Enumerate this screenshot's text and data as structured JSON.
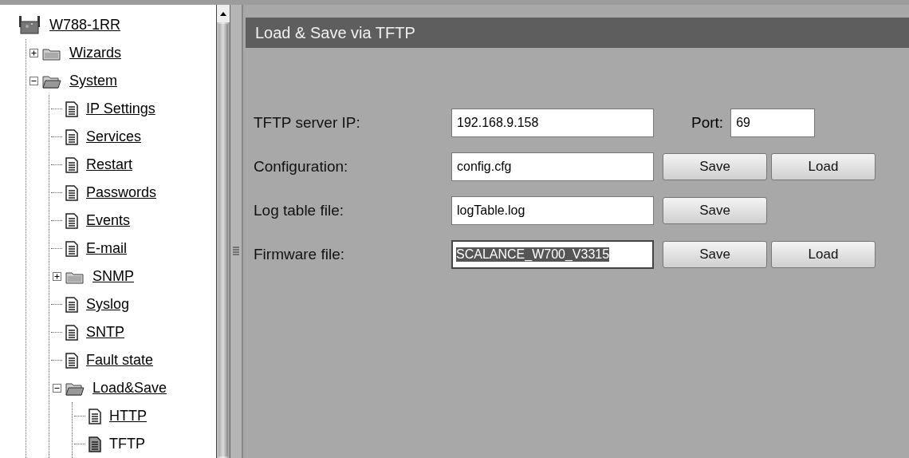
{
  "tree": {
    "label": "W788-1RR",
    "kind": "device",
    "selected": false,
    "children": [
      {
        "label": "Wizards",
        "kind": "folder",
        "expanded": false,
        "selected": false
      },
      {
        "label": "System",
        "kind": "folder",
        "expanded": true,
        "selected": false,
        "children": [
          {
            "label": "IP Settings",
            "kind": "page",
            "selected": false
          },
          {
            "label": "Services",
            "kind": "page",
            "selected": false
          },
          {
            "label": "Restart",
            "kind": "page",
            "selected": false
          },
          {
            "label": "Passwords",
            "kind": "page",
            "selected": false
          },
          {
            "label": "Events",
            "kind": "page",
            "selected": false
          },
          {
            "label": "E-mail",
            "kind": "page",
            "selected": false
          },
          {
            "label": "SNMP",
            "kind": "folder",
            "expanded": false,
            "selected": false
          },
          {
            "label": "Syslog",
            "kind": "page",
            "selected": false
          },
          {
            "label": "SNTP",
            "kind": "page",
            "selected": false
          },
          {
            "label": "Fault state",
            "kind": "page",
            "selected": false
          },
          {
            "label": "Load&Save",
            "kind": "folder",
            "expanded": true,
            "selected": false,
            "children": [
              {
                "label": "HTTP",
                "kind": "page",
                "selected": false
              },
              {
                "label": "TFTP",
                "kind": "page",
                "selected": true
              }
            ]
          }
        ]
      }
    ]
  },
  "page": {
    "title": "Load & Save via TFTP",
    "rows": [
      {
        "label": "TFTP server IP:",
        "value": "192.168.9.158",
        "highlighted": false,
        "port": {
          "label": "Port:",
          "value": "69"
        }
      },
      {
        "label": "Configuration:",
        "value": "config.cfg",
        "highlighted": false,
        "buttons": [
          "Save",
          "Load"
        ]
      },
      {
        "label": "Log table file:",
        "value": "logTable.log",
        "highlighted": false,
        "buttons": [
          "Save"
        ]
      },
      {
        "label": "Firmware file:",
        "value": "SCALANCE_W700_V3315",
        "highlighted": true,
        "buttons": [
          "Save",
          "Load"
        ]
      }
    ]
  }
}
